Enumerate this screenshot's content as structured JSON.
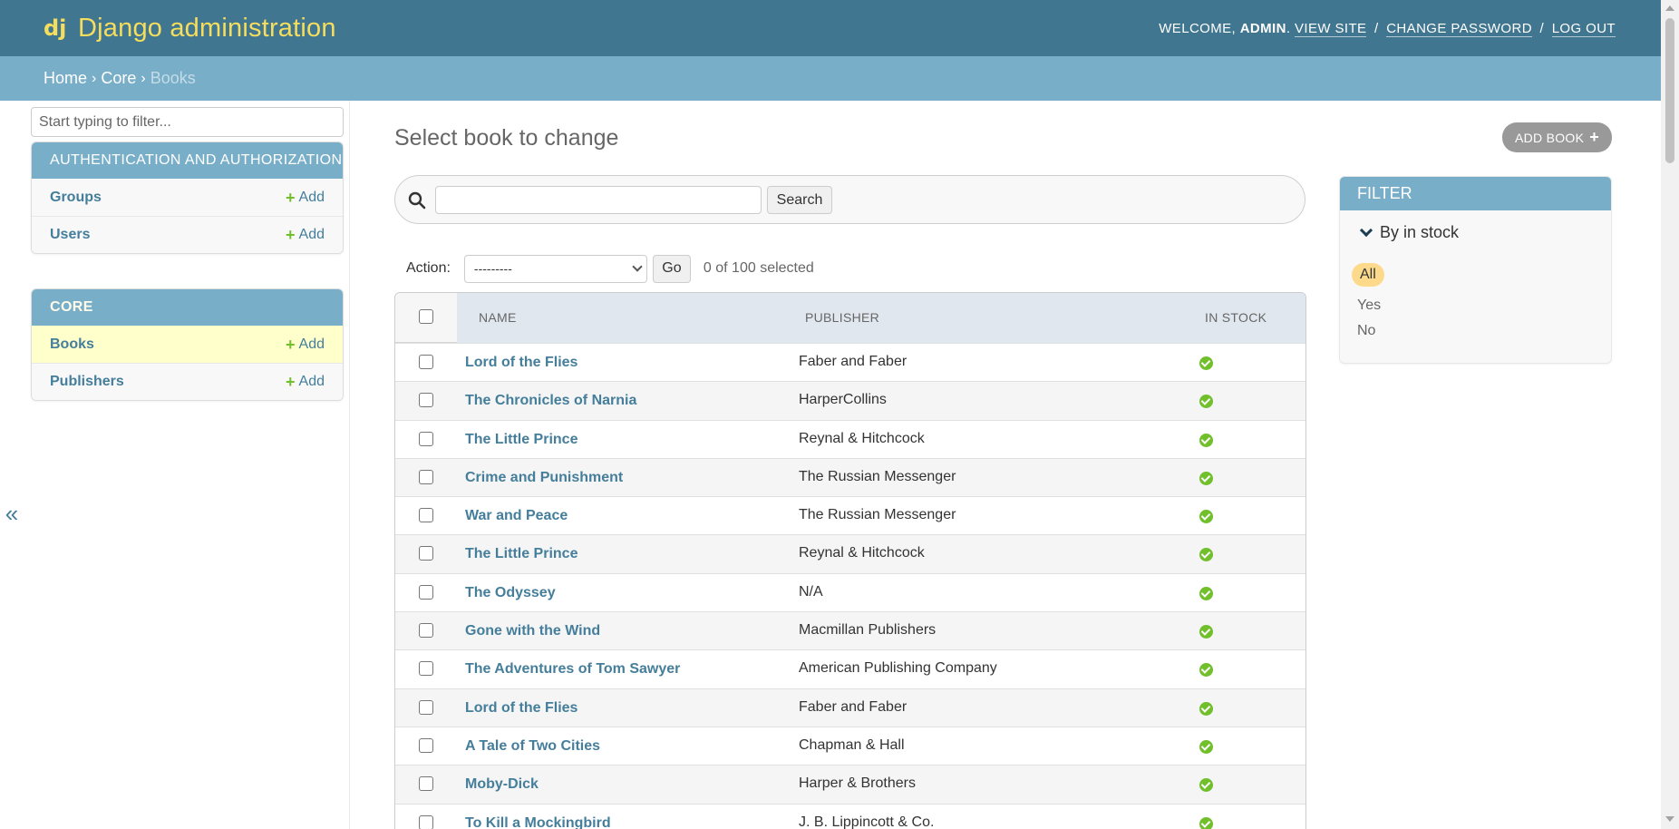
{
  "header": {
    "site_title": "Django administration",
    "welcome": "WELCOME,",
    "username": "ADMIN",
    "view_site": "VIEW SITE",
    "change_password": "CHANGE PASSWORD",
    "log_out": "LOG OUT",
    "separator": "/"
  },
  "breadcrumbs": {
    "home": "Home",
    "core": "Core",
    "current": "Books",
    "separator": "›"
  },
  "sidebar": {
    "filter_placeholder": "Start typing to filter...",
    "collapse_glyph": "«",
    "modules": [
      {
        "caption": "AUTHENTICATION AND AUTHORIZATION",
        "models": [
          {
            "name": "Groups",
            "add": "Add"
          },
          {
            "name": "Users",
            "add": "Add"
          }
        ]
      },
      {
        "caption": "CORE",
        "models": [
          {
            "name": "Books",
            "add": "Add",
            "current": true
          },
          {
            "name": "Publishers",
            "add": "Add"
          }
        ]
      }
    ]
  },
  "content": {
    "title": "Select book to change",
    "add_button": "ADD BOOK",
    "search_button": "Search",
    "action_label": "Action:",
    "action_selected": "---------",
    "go_button": "Go",
    "counter": "0 of 100 selected",
    "columns": {
      "name": "NAME",
      "publisher": "PUBLISHER",
      "in_stock": "IN STOCK"
    },
    "rows": [
      {
        "name": "Lord of the Flies",
        "publisher": "Faber and Faber",
        "in_stock": true
      },
      {
        "name": "The Chronicles of Narnia",
        "publisher": "HarperCollins",
        "in_stock": true
      },
      {
        "name": "The Little Prince",
        "publisher": "Reynal & Hitchcock",
        "in_stock": true
      },
      {
        "name": "Crime and Punishment",
        "publisher": "The Russian Messenger",
        "in_stock": true
      },
      {
        "name": "War and Peace",
        "publisher": "The Russian Messenger",
        "in_stock": true
      },
      {
        "name": "The Little Prince",
        "publisher": "Reynal & Hitchcock",
        "in_stock": true
      },
      {
        "name": "The Odyssey",
        "publisher": "N/A",
        "in_stock": true
      },
      {
        "name": "Gone with the Wind",
        "publisher": "Macmillan Publishers",
        "in_stock": true
      },
      {
        "name": "The Adventures of Tom Sawyer",
        "publisher": "American Publishing Company",
        "in_stock": true
      },
      {
        "name": "Lord of the Flies",
        "publisher": "Faber and Faber",
        "in_stock": true
      },
      {
        "name": "A Tale of Two Cities",
        "publisher": "Chapman & Hall",
        "in_stock": true
      },
      {
        "name": "Moby-Dick",
        "publisher": "Harper & Brothers",
        "in_stock": true
      },
      {
        "name": "To Kill a Mockingbird",
        "publisher": "J. B. Lippincott & Co.",
        "in_stock": true
      }
    ]
  },
  "filter": {
    "caption": "FILTER",
    "heading": "By in stock",
    "options": [
      {
        "label": "All",
        "selected": true
      },
      {
        "label": "Yes"
      },
      {
        "label": "No"
      }
    ]
  },
  "colors": {
    "header": "#417690",
    "breadcrumbs": "#79aec8",
    "brand": "#f5dd5d",
    "link": "#447e9b",
    "add_green": "#70bf2b",
    "selected_filter": "#fdda8b"
  }
}
